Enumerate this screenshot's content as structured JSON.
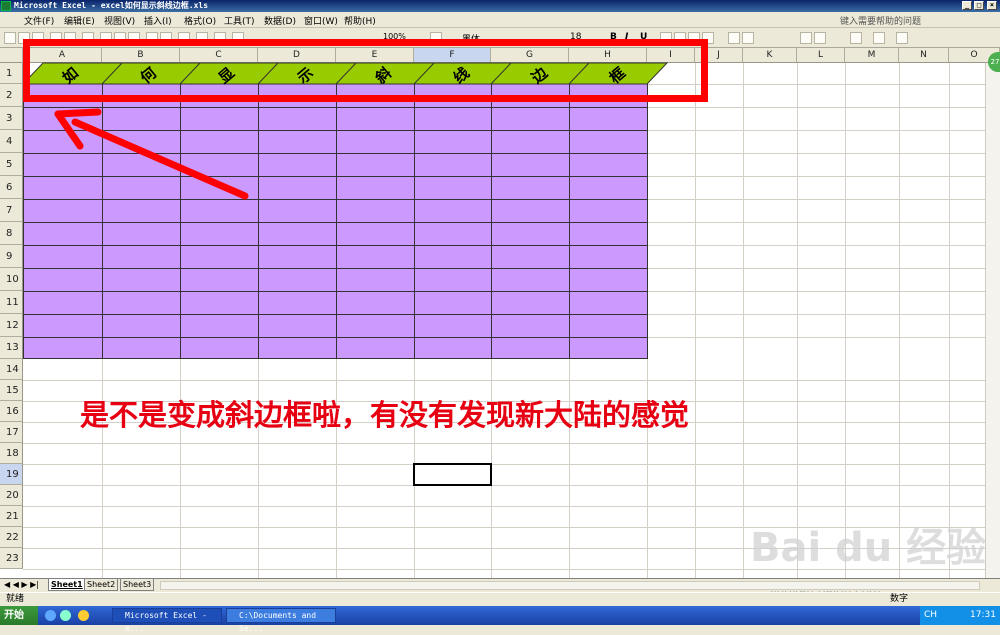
{
  "window": {
    "title": "Microsoft Excel - excel如何显示斜线边框.xls"
  },
  "menu": {
    "items": [
      "文件(F)",
      "编辑(E)",
      "视图(V)",
      "插入(I)",
      "格式(O)",
      "工具(T)",
      "数据(D)",
      "窗口(W)",
      "帮助(H)"
    ],
    "help_placeholder": "键入需要帮助的问题"
  },
  "toolbar": {
    "zoom": "100%",
    "font": "黑体",
    "size": "18",
    "bold": "B",
    "italic": "I",
    "underline": "U"
  },
  "columns": [
    "A",
    "B",
    "C",
    "D",
    "E",
    "F",
    "G",
    "H",
    "I",
    "J",
    "K",
    "L",
    "M",
    "N",
    "O"
  ],
  "rows": [
    "1",
    "2",
    "3",
    "4",
    "5",
    "6",
    "7",
    "8",
    "9",
    "10",
    "11",
    "12",
    "13",
    "14",
    "15",
    "16",
    "17",
    "18",
    "19",
    "20",
    "21",
    "22",
    "23"
  ],
  "header_chars": [
    "如",
    "何",
    "显",
    "示",
    "斜",
    "线",
    "边",
    "框"
  ],
  "annotation": "是不是变成斜边框啦，有没有发现新大陆的感觉",
  "sheets": [
    "Sheet1",
    "Sheet2",
    "Sheet3"
  ],
  "status": {
    "left": "就绪",
    "right": "数字"
  },
  "taskbar": {
    "start": "开始",
    "tasks": [
      "Microsoft Excel - e...",
      "C:\\Documents and Se..."
    ],
    "ime": "CH",
    "clock": "17:31"
  },
  "watermark": {
    "brand": "Bai du 经验",
    "url": "jingyan.baidu.com"
  },
  "badge": "27",
  "colors": {
    "header_green": "#99cc00",
    "body_purple": "#cc99ff",
    "annotation_red": "#e60012",
    "frame_red": "#ff0000"
  }
}
